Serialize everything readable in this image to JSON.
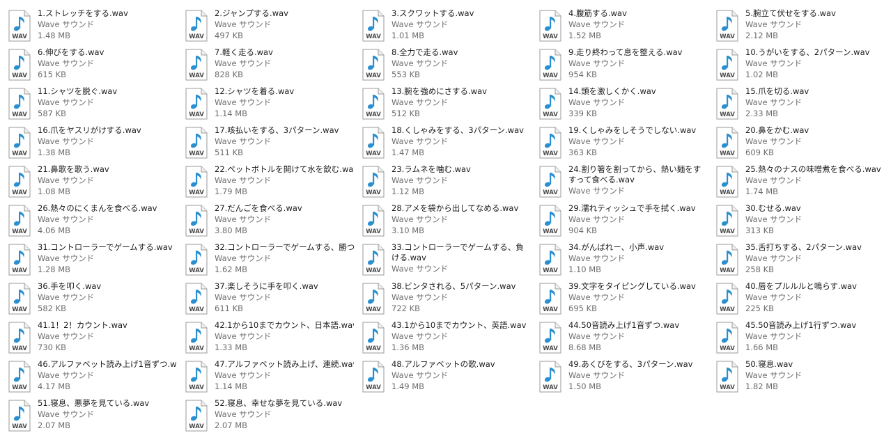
{
  "files": [
    {
      "name": "1.ストレッチをする.wav",
      "type": "Wave サウンド",
      "size": "1.48 MB"
    },
    {
      "name": "2.ジャンプする.wav",
      "type": "Wave サウンド",
      "size": "497 KB"
    },
    {
      "name": "3.スクワットする.wav",
      "type": "Wave サウンド",
      "size": "1.01 MB"
    },
    {
      "name": "4.腹筋する.wav",
      "type": "Wave サウンド",
      "size": "1.52 MB"
    },
    {
      "name": "5.腕立て伏せをする.wav",
      "type": "Wave サウンド",
      "size": "2.12 MB"
    },
    {
      "name": "6.伸びをする.wav",
      "type": "Wave サウンド",
      "size": "615 KB"
    },
    {
      "name": "7.軽く走る.wav",
      "type": "Wave サウンド",
      "size": "828 KB"
    },
    {
      "name": "8.全力で走る.wav",
      "type": "Wave サウンド",
      "size": "553 KB"
    },
    {
      "name": "9.走り終わって息を整える.wav",
      "type": "Wave サウンド",
      "size": "954 KB"
    },
    {
      "name": "10.うがいをする、2パターン.wav",
      "type": "Wave サウンド",
      "size": "1.02 MB"
    },
    {
      "name": "11.シャツを脱ぐ.wav",
      "type": "Wave サウンド",
      "size": "587 KB"
    },
    {
      "name": "12.シャツを着る.wav",
      "type": "Wave サウンド",
      "size": "1.14 MB"
    },
    {
      "name": "13.腕を強めにさする.wav",
      "type": "Wave サウンド",
      "size": "512 KB"
    },
    {
      "name": "14.頭を激しくかく.wav",
      "type": "Wave サウンド",
      "size": "339 KB"
    },
    {
      "name": "15.爪を切る.wav",
      "type": "Wave サウンド",
      "size": "2.33 MB"
    },
    {
      "name": "16.爪をヤスリがけする.wav",
      "type": "Wave サウンド",
      "size": "1.38 MB"
    },
    {
      "name": "17.咳払いをする、3パターン.wav",
      "type": "Wave サウンド",
      "size": "511 KB"
    },
    {
      "name": "18.くしゃみをする、3パターン.wav",
      "type": "Wave サウンド",
      "size": "1.47 MB"
    },
    {
      "name": "19.くしゃみをしそうでしない.wav",
      "type": "Wave サウンド",
      "size": "363 KB"
    },
    {
      "name": "20.鼻をかむ.wav",
      "type": "Wave サウンド",
      "size": "609 KB"
    },
    {
      "name": "21.鼻歌を歌う.wav",
      "type": "Wave サウンド",
      "size": "1.08 MB"
    },
    {
      "name": "22.ペットボトルを開けて水を飲む.wav",
      "type": "Wave サウンド",
      "size": "1.79 MB"
    },
    {
      "name": "23.ラムネを噛む.wav",
      "type": "Wave サウンド",
      "size": "1.12 MB"
    },
    {
      "name": "24.割り箸を割ってから、熱い麺をすすって食べる.wav",
      "type": "Wave サウンド",
      "size": ""
    },
    {
      "name": "25.熱々のナスの味噌煮を食べる.wav",
      "type": "Wave サウンド",
      "size": "1.74 MB"
    },
    {
      "name": "26.熱々のにくまんを食べる.wav",
      "type": "Wave サウンド",
      "size": "4.06 MB"
    },
    {
      "name": "27.だんごを食べる.wav",
      "type": "Wave サウンド",
      "size": "3.80 MB"
    },
    {
      "name": "28.アメを袋から出してなめる.wav",
      "type": "Wave サウンド",
      "size": "3.10 MB"
    },
    {
      "name": "29.濡れティッシュで手を拭く.wav",
      "type": "Wave サウンド",
      "size": "904 KB"
    },
    {
      "name": "30.むせる.wav",
      "type": "Wave サウンド",
      "size": "313 KB"
    },
    {
      "name": "31.コントローラーでゲームする.wav",
      "type": "Wave サウンド",
      "size": "1.28 MB"
    },
    {
      "name": "32.コントローラーでゲームする、勝つ.wav",
      "type": "Wave サウンド",
      "size": "1.62 MB"
    },
    {
      "name": "33.コントローラーでゲームする、負ける.wav",
      "type": "Wave サウンド",
      "size": ""
    },
    {
      "name": "34.がんばれー、小声.wav",
      "type": "Wave サウンド",
      "size": "1.10 MB"
    },
    {
      "name": "35.舌打ちする、2パターン.wav",
      "type": "Wave サウンド",
      "size": "258 KB"
    },
    {
      "name": "36.手を叩く.wav",
      "type": "Wave サウンド",
      "size": "582 KB"
    },
    {
      "name": "37.楽しそうに手を叩く.wav",
      "type": "Wave サウンド",
      "size": "611 KB"
    },
    {
      "name": "38.ビンタされる、5パターン.wav",
      "type": "Wave サウンド",
      "size": "722 KB"
    },
    {
      "name": "39.文字をタイピングしている.wav",
      "type": "Wave サウンド",
      "size": "695 KB"
    },
    {
      "name": "40.唇をプルルルと鳴らす.wav",
      "type": "Wave サウンド",
      "size": "225 KB"
    },
    {
      "name": "41.1！2！カウント.wav",
      "type": "Wave サウンド",
      "size": "730 KB"
    },
    {
      "name": "42.1から10までカウント、日本語.wav",
      "type": "Wave サウンド",
      "size": "1.33 MB"
    },
    {
      "name": "43.1から10までカウント、英語.wav",
      "type": "Wave サウンド",
      "size": "1.36 MB"
    },
    {
      "name": "44.50音読み上げ1音ずつ.wav",
      "type": "Wave サウンド",
      "size": "8.68 MB"
    },
    {
      "name": "45.50音読み上げ1行ずつ.wav",
      "type": "Wave サウンド",
      "size": "1.66 MB"
    },
    {
      "name": "46.アルファベット読み上げ1音ずつ.wav",
      "type": "Wave サウンド",
      "size": "4.17 MB"
    },
    {
      "name": "47.アルファベット読み上げ、連続.wav",
      "type": "Wave サウンド",
      "size": "1.14 MB"
    },
    {
      "name": "48.アルファベットの歌.wav",
      "type": "Wave サウンド",
      "size": "1.49 MB"
    },
    {
      "name": "49.あくびをする、3パターン.wav",
      "type": "Wave サウンド",
      "size": "1.50 MB"
    },
    {
      "name": "50.寝息.wav",
      "type": "Wave サウンド",
      "size": "1.82 MB"
    },
    {
      "name": "51.寝息、悪夢を見ている.wav",
      "type": "Wave サウンド",
      "size": "2.07 MB"
    },
    {
      "name": "52.寝息、幸せな夢を見ている.wav",
      "type": "Wave サウンド",
      "size": "2.07 MB"
    }
  ],
  "icon": {
    "name": "wav-file-icon",
    "label": "WAV",
    "note_color": "#2a8fd0",
    "label_color": "#4a4a4a",
    "page_color": "#ffffff",
    "border_color": "#9a9a9a"
  }
}
